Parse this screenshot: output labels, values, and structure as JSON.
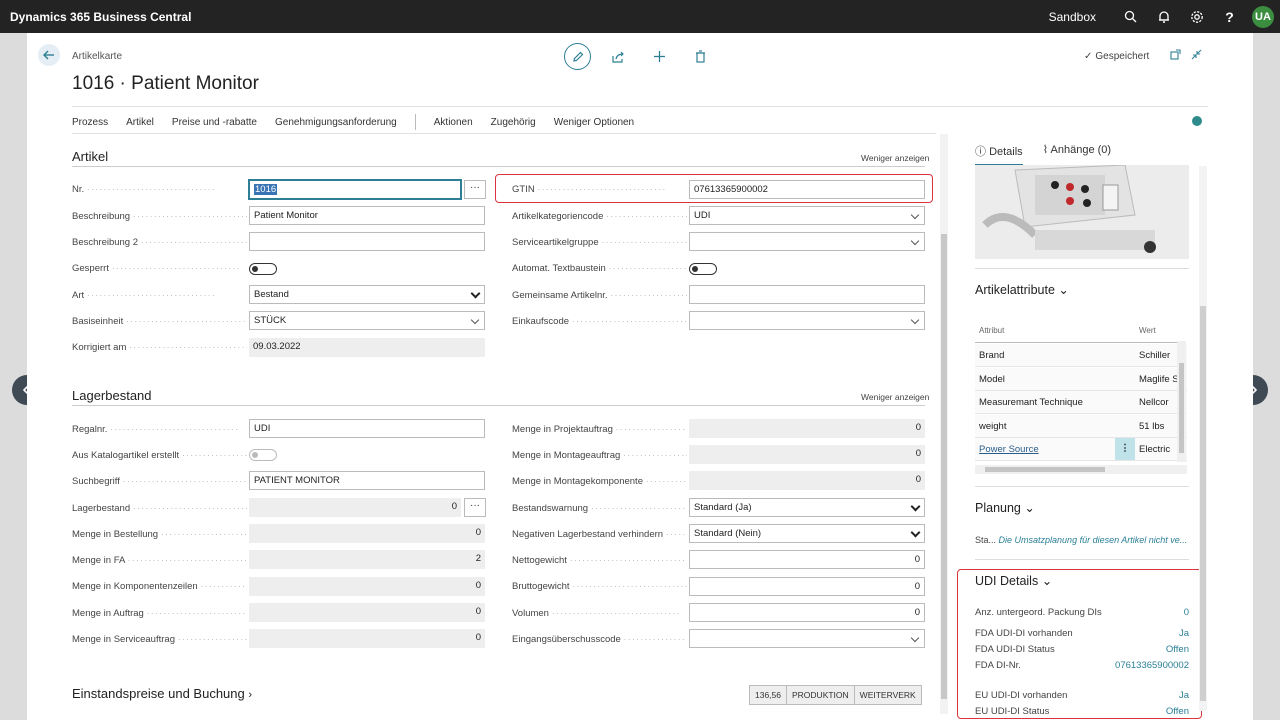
{
  "topbar": {
    "app_title": "Dynamics 365 Business Central",
    "env": "Sandbox",
    "avatar": "UA"
  },
  "page": {
    "breadcrumb": "Artikelkarte",
    "title": "1016 · Patient Monitor",
    "saved_label": "Gespeichert"
  },
  "menu": {
    "items": [
      "Prozess",
      "Artikel",
      "Preise und -rabatte",
      "Genehmigungsanforderung"
    ],
    "items2": [
      "Aktionen",
      "Zugehörig",
      "Weniger Optionen"
    ]
  },
  "artikel": {
    "title": "Artikel",
    "less_label": "Weniger anzeigen",
    "left": [
      {
        "label": "Nr.",
        "value": "1016"
      },
      {
        "label": "Beschreibung",
        "value": "Patient Monitor"
      },
      {
        "label": "Beschreibung 2",
        "value": ""
      },
      {
        "label": "Gesperrt",
        "value": ""
      },
      {
        "label": "Art",
        "value": "Bestand"
      },
      {
        "label": "Basiseinheit",
        "value": "STÜCK"
      },
      {
        "label": "Korrigiert am",
        "value": "09.03.2022"
      }
    ],
    "right": [
      {
        "label": "GTIN",
        "value": "07613365900002"
      },
      {
        "label": "Artikelkategoriencode",
        "value": "UDI"
      },
      {
        "label": "Serviceartikelgruppe",
        "value": ""
      },
      {
        "label": "Automat. Textbaustein",
        "value": ""
      },
      {
        "label": "Gemeinsame Artikelnr.",
        "value": ""
      },
      {
        "label": "Einkaufscode",
        "value": ""
      }
    ]
  },
  "lager": {
    "title": "Lagerbestand",
    "less_label": "Weniger anzeigen",
    "left": [
      {
        "label": "Regalnr.",
        "value": "UDI"
      },
      {
        "label": "Aus Katalogartikel erstellt",
        "value": ""
      },
      {
        "label": "Suchbegriff",
        "value": "PATIENT MONITOR"
      },
      {
        "label": "Lagerbestand",
        "value": "0"
      },
      {
        "label": "Menge in Bestellung",
        "value": "0"
      },
      {
        "label": "Menge in FA",
        "value": "2"
      },
      {
        "label": "Menge in Komponentenzeilen",
        "value": "0"
      },
      {
        "label": "Menge in Auftrag",
        "value": "0"
      },
      {
        "label": "Menge in Serviceauftrag",
        "value": "0"
      }
    ],
    "right": [
      {
        "label": "Menge in Projektauftrag",
        "value": "0"
      },
      {
        "label": "Menge in Montageauftrag",
        "value": "0"
      },
      {
        "label": "Menge in Montagekomponente",
        "value": "0"
      },
      {
        "label": "Bestandswarnung",
        "value": "Standard (Ja)"
      },
      {
        "label": "Negativen Lagerbestand verhindern",
        "value": "Standard (Nein)"
      },
      {
        "label": "Nettogewicht",
        "value": "0"
      },
      {
        "label": "Bruttogewicht",
        "value": "0"
      },
      {
        "label": "Volumen",
        "value": "0"
      },
      {
        "label": "Eingangsüberschusscode",
        "value": ""
      }
    ]
  },
  "einstand": {
    "title": "Einstandspreise und Buchung",
    "tabs": [
      "136,56",
      "PRODUKTION",
      "WEITERVERK"
    ]
  },
  "factbox": {
    "tab_details": "Details",
    "tab_attachments": "Anhänge (0)",
    "attr_title": "Artikelattribute",
    "attr_col1": "Attribut",
    "attr_col2": "Wert",
    "attributes": [
      {
        "k": "Brand",
        "v": "Schiller"
      },
      {
        "k": "Model",
        "v": "Maglife S"
      },
      {
        "k": "Measuremant Technique",
        "v": "Nellcor"
      },
      {
        "k": "weight",
        "v": "51 lbs"
      },
      {
        "k": "Power Source",
        "v": "Electric"
      }
    ],
    "planung_title": "Planung",
    "planung_label": "Sta...",
    "planung_link": "Die Umsatzplanung für diesen Artikel nicht ve...",
    "udi_title": "UDI Details",
    "udi": [
      {
        "k": "Anz. untergeord. Packung DIs",
        "v": "0"
      },
      {
        "k": "FDA UDI-DI vorhanden",
        "v": "Ja"
      },
      {
        "k": "FDA UDI-DI Status",
        "v": "Offen"
      },
      {
        "k": "FDA DI-Nr.",
        "v": "07613365900002"
      },
      {
        "k": "EU UDI-DI vorhanden",
        "v": "Ja"
      },
      {
        "k": "EU UDI-DI Status",
        "v": "Offen"
      }
    ]
  },
  "colors": {
    "accent": "#2e7f95",
    "highlight": "#d9343d",
    "topbar": "#232323"
  }
}
